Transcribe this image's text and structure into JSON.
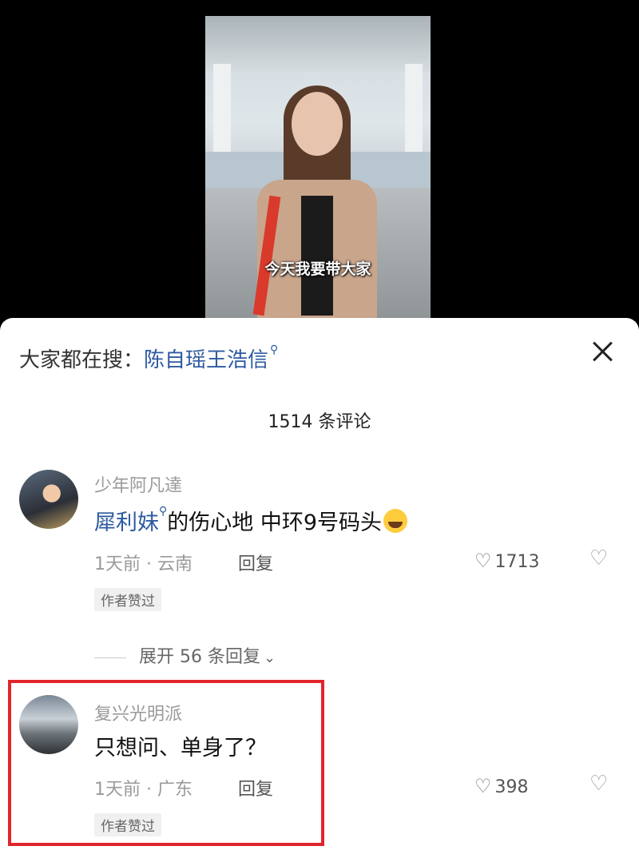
{
  "video": {
    "caption": "今天我要带大家"
  },
  "search_bar": {
    "label": "大家都在搜：",
    "keyword": "陈自瑶王浩信",
    "keyword_icon": "search-icon"
  },
  "comment_count": "1514 条评论",
  "comments": [
    {
      "username": "少年阿凡達",
      "text_link": "犀利妹",
      "text_rest": "的伤心地  中环9号码头",
      "emoji": "crying-face-emoji",
      "meta": "1天前 · 云南",
      "reply_label": "回复",
      "likes": "1713",
      "badge": "作者赞过",
      "expand": "展开 56 条回复"
    },
    {
      "username": "复兴光明派",
      "text": "只想问、单身了？",
      "meta": "1天前 · 广东",
      "reply_label": "回复",
      "likes": "398",
      "badge": "作者赞过"
    }
  ],
  "colors": {
    "link": "#2d5aa0",
    "highlight_border": "#e0262b"
  }
}
